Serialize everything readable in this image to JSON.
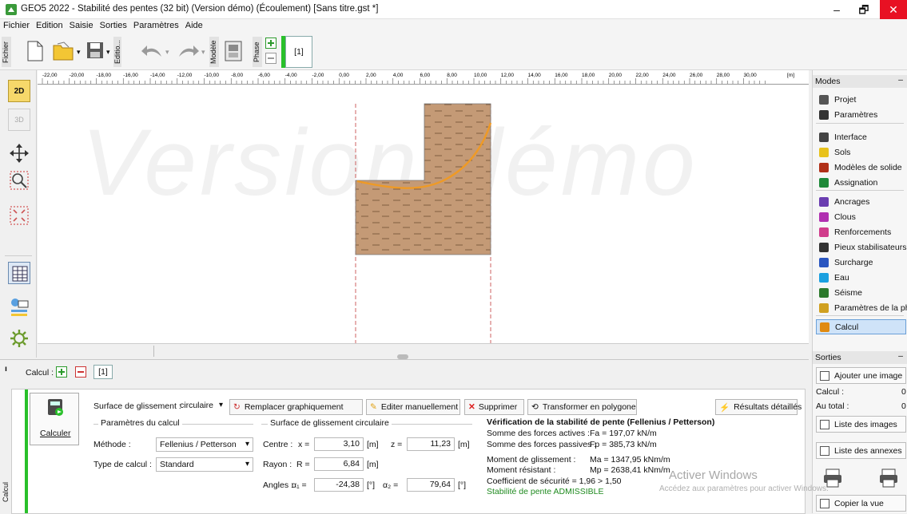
{
  "window": {
    "title": "GEO5 2022 - Stabilité des pentes (32 bit) (Version démo) (Écoulement) [Sans titre.gst *]",
    "minimize": "–",
    "maximize": "🗗",
    "close": "✕"
  },
  "menu": [
    "Fichier",
    "Edition",
    "Saisie",
    "Sorties",
    "Paramètres",
    "Aide"
  ],
  "toolbar": {
    "file_label": "Fichier",
    "edit_label": "Editio...",
    "model_label": "Modèle",
    "phase_label": "Phase",
    "phase_number": "[1]"
  },
  "ruler": {
    "ticks": [
      "-22,00",
      "-20,00",
      "-18,00",
      "-16,00",
      "-14,00",
      "-12,00",
      "-10,00",
      "-8,00",
      "-6,00",
      "-4,00",
      "-2,00",
      "0,00",
      "2,00",
      "4,00",
      "6,00",
      "8,00",
      "10,00",
      "12,00",
      "14,00",
      "16,00",
      "18,00",
      "20,00",
      "22,00",
      "24,00",
      "26,00",
      "28,00",
      "30,00"
    ],
    "unit": "[m]"
  },
  "left_tools": {
    "view2d": "2D",
    "view3d": "3D"
  },
  "watermark": "Version démo",
  "modes": {
    "header": "Modes",
    "items": [
      {
        "label": "Projet",
        "icon": "document-icon",
        "color": "#555555"
      },
      {
        "label": "Paramètres",
        "icon": "gear-icon",
        "color": "#333333"
      },
      {
        "label": "Interface",
        "icon": "interface-icon",
        "color": "#444444"
      },
      {
        "label": "Sols",
        "icon": "soil-icon",
        "color": "#e8c21c"
      },
      {
        "label": "Modèles de solide",
        "icon": "rigid-body-icon",
        "color": "#b03018"
      },
      {
        "label": "Assignation",
        "icon": "assign-icon",
        "color": "#1f8a3a"
      },
      {
        "label": "Ancrages",
        "icon": "anchor-icon",
        "color": "#6a3db0"
      },
      {
        "label": "Clous",
        "icon": "nail-icon",
        "color": "#b030b0"
      },
      {
        "label": "Renforcements",
        "icon": "reinforcement-icon",
        "color": "#d03c8c"
      },
      {
        "label": "Pieux stabilisateurs",
        "icon": "pile-icon",
        "color": "#333333"
      },
      {
        "label": "Surcharge",
        "icon": "surcharge-icon",
        "color": "#2a56c0"
      },
      {
        "label": "Eau",
        "icon": "water-icon",
        "color": "#1aa0e0"
      },
      {
        "label": "Séisme",
        "icon": "earthquake-icon",
        "color": "#2d7a2d"
      },
      {
        "label": "Paramètres de la phase",
        "icon": "phase-params-icon",
        "color": "#d0a020"
      },
      {
        "label": "Calcul",
        "icon": "calc-icon",
        "color": "#e08a10"
      }
    ]
  },
  "outputs": {
    "header": "Sorties",
    "add_image": "Ajouter une image",
    "calc_label": "Calcul :",
    "calc_count": "0",
    "total_label": "Au total :",
    "total_count": "0",
    "list_images": "Liste des images",
    "list_annexes": "Liste des annexes",
    "copy_view": "Copier la vue"
  },
  "activation": {
    "title": "Activer Windows",
    "subtitle": "Accédez aux paramètres pour activer Windows."
  },
  "calc": {
    "label": "Calcul :",
    "phase": "[1]",
    "side_tab": "Calcul",
    "calculate": "Calculer",
    "surface_label": "Surface de glissement :",
    "surface_value": "circulaire",
    "btn_replace": "Remplacer graphiquement",
    "btn_edit": "Editer manuellement",
    "btn_delete": "Supprimer",
    "btn_polygon": "Transformer en polygone",
    "btn_results": "Résultats détaillés",
    "params_title": "Paramètres du calcul",
    "method_label": "Méthode :",
    "method_value": "Fellenius / Petterson",
    "type_label": "Type de calcul :",
    "type_value": "Standard",
    "circ_title": "Surface de glissement circulaire",
    "centre_label": "Centre :",
    "x_label": "x =",
    "x_value": "3,10",
    "z_label": "z =",
    "z_value": "11,23",
    "unit_m": "[m]",
    "radius_label": "Rayon :",
    "r_label": "R =",
    "r_value": "6,84",
    "angles_label": "Angles :",
    "a1_label": "α₁ =",
    "a1_value": "-24,38",
    "a2_label": "α₂ =",
    "a2_value": "79,64",
    "unit_deg": "[°]"
  },
  "results": {
    "title": "Vérification de la stabilité de pente (Fellenius / Petterson)",
    "l1": "Somme des forces actives :",
    "v1": "Fa = 197,07 kN/m",
    "l2": "Somme des forces passives :",
    "v2": "Fp = 385,73 kN/m",
    "l3": "Moment de glissement :",
    "v3": "Ma = 1347,95 kNm/m",
    "l4": "Moment résistant :",
    "v4": "Mp = 2638,41 kNm/m",
    "l5": "Coefficient de sécurité = 1,96 > 1,50",
    "l6": "Stabilité de pente ADMISSIBLE"
  }
}
